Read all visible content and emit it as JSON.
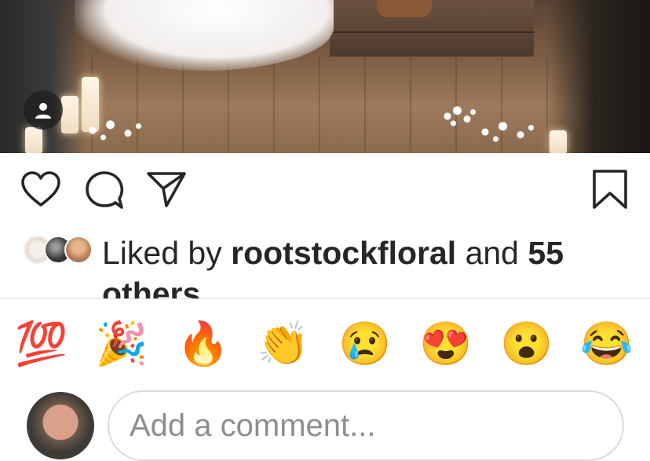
{
  "post": {
    "photo": {
      "description_icon": "wedding-photo"
    }
  },
  "tag_badge": {
    "icon": "person-icon"
  },
  "actions": {
    "like_icon": "heart-icon",
    "comment_icon": "comment-bubble-icon",
    "share_icon": "paper-plane-icon",
    "save_icon": "bookmark-icon"
  },
  "likes": {
    "prefix": "Liked by",
    "username": "rootstockfloral",
    "connector": "and",
    "count": "55",
    "suffix": "others"
  },
  "reactions": [
    {
      "emoji": "💯",
      "icon": "hundred-points-emoji"
    },
    {
      "emoji": "🎉",
      "icon": "party-popper-emoji"
    },
    {
      "emoji": "🔥",
      "icon": "fire-emoji"
    },
    {
      "emoji": "👏",
      "icon": "clapping-hands-emoji"
    },
    {
      "emoji": "😢",
      "icon": "crying-face-emoji"
    },
    {
      "emoji": "😍",
      "icon": "heart-eyes-emoji"
    },
    {
      "emoji": "😮",
      "icon": "surprised-face-emoji"
    },
    {
      "emoji": "😂",
      "icon": "tears-of-joy-emoji"
    }
  ],
  "comment": {
    "placeholder": "Add a comment..."
  },
  "colors": {
    "text": "#262626",
    "placeholder": "#8e8e8e",
    "divider": "#dbdbdb"
  }
}
